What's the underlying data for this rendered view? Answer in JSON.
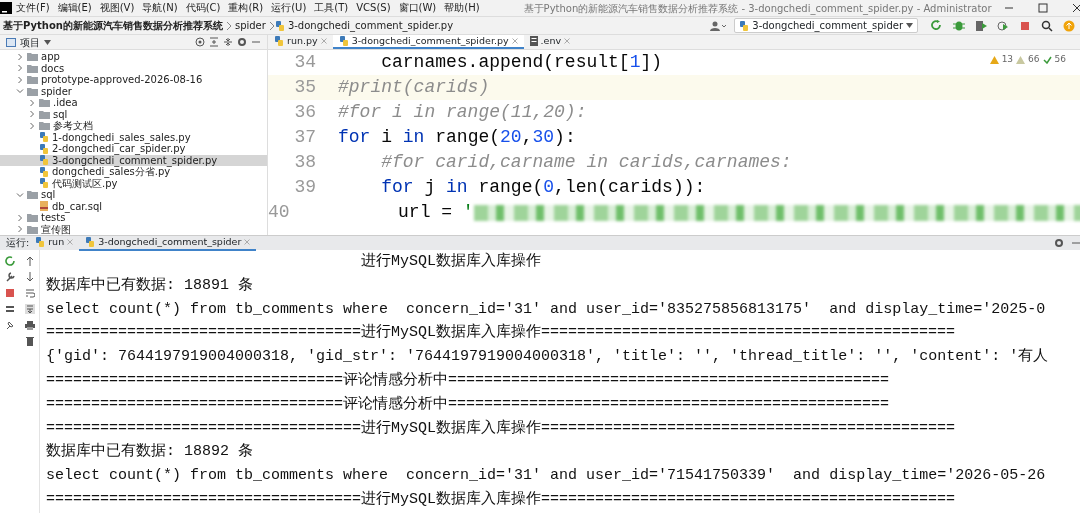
{
  "menu": [
    "文件(F)",
    "编辑(E)",
    "视图(V)",
    "导航(N)",
    "代码(C)",
    "重构(R)",
    "运行(U)",
    "工具(T)",
    "VCS(S)",
    "窗口(W)",
    "帮助(H)"
  ],
  "window": {
    "title": "基于Python的新能源汽车销售数据分析推荐系统 - 3-dongchedi_comment_spider.py - Administrator"
  },
  "breadcrumb": [
    "基于Python的新能源汽车销售数据分析推荐系统",
    "spider",
    "3-dongchedi_comment_spider.py"
  ],
  "run_config": "3-dongchedi_comment_spider",
  "project_panel": {
    "title": "项目",
    "tree": [
      {
        "label": "app",
        "kind": "folder",
        "expanded": false,
        "selected": false
      },
      {
        "label": "docs",
        "kind": "folder",
        "expanded": false,
        "selected": false
      },
      {
        "label": "prototype-approved-2026-08-16",
        "kind": "folder",
        "expanded": false,
        "selected": false
      },
      {
        "label": "spider",
        "kind": "folder",
        "expanded": true,
        "selected": false,
        "children": [
          {
            "label": ".idea",
            "kind": "folder",
            "expanded": false,
            "selected": false
          },
          {
            "label": "sql",
            "kind": "folder",
            "expanded": false,
            "selected": false
          },
          {
            "label": "参考文档",
            "kind": "folder",
            "expanded": false,
            "selected": false
          },
          {
            "label": "1-dongchedi_sales_sales.py",
            "kind": "python",
            "selected": false
          },
          {
            "label": "2-dongchedi_car_spider.py",
            "kind": "python",
            "selected": false
          },
          {
            "label": "3-dongchedi_comment_spider.py",
            "kind": "python",
            "selected": true
          },
          {
            "label": "dongchedi_sales分省.py",
            "kind": "python",
            "selected": false
          },
          {
            "label": "代码测试区.py",
            "kind": "python",
            "selected": false
          }
        ]
      },
      {
        "label": "sql",
        "kind": "folder",
        "expanded": true,
        "selected": false,
        "children": [
          {
            "label": "db_car.sql",
            "kind": "sql",
            "selected": false
          }
        ]
      },
      {
        "label": "tests",
        "kind": "folder",
        "expanded": false,
        "selected": false
      },
      {
        "label": "宣传图",
        "kind": "folder",
        "expanded": false,
        "selected": false
      }
    ]
  },
  "editor_tabs": [
    {
      "label": "run.py",
      "kind": "python",
      "selected": false
    },
    {
      "label": "3-dongchedi_comment_spider.py",
      "kind": "python",
      "selected": true
    },
    {
      "label": ".env",
      "kind": "text",
      "selected": false
    }
  ],
  "inspections": {
    "warnings": "13",
    "weak_warnings": "66",
    "ok": "56"
  },
  "code_lines": [
    {
      "number": "34",
      "current": false,
      "tokens": [
        {
          "kind": "plain",
          "text": "    carnames.append(result["
        },
        {
          "kind": "number",
          "text": "1"
        },
        {
          "kind": "plain",
          "text": "])"
        }
      ]
    },
    {
      "number": "35",
      "current": true,
      "tokens": [
        {
          "kind": "comment",
          "text": "#print(carids)"
        }
      ]
    },
    {
      "number": "36",
      "current": false,
      "tokens": [
        {
          "kind": "comment",
          "text": "#for i in range(11,20):"
        }
      ]
    },
    {
      "number": "37",
      "current": false,
      "tokens": [
        {
          "kind": "keyword",
          "text": "for"
        },
        {
          "kind": "plain",
          "text": " i "
        },
        {
          "kind": "keyword",
          "text": "in"
        },
        {
          "kind": "plain",
          "text": " range("
        },
        {
          "kind": "number",
          "text": "20"
        },
        {
          "kind": "plain",
          "text": ","
        },
        {
          "kind": "number",
          "text": "30"
        },
        {
          "kind": "plain",
          "text": "):"
        }
      ]
    },
    {
      "number": "38",
      "current": false,
      "tokens": [
        {
          "kind": "comment",
          "text": "    #for carid,carname in carids,carnames:"
        }
      ]
    },
    {
      "number": "39",
      "current": false,
      "tokens": [
        {
          "kind": "keyword",
          "text": "    for"
        },
        {
          "kind": "plain",
          "text": " j "
        },
        {
          "kind": "keyword",
          "text": "in"
        },
        {
          "kind": "plain",
          "text": " range("
        },
        {
          "kind": "number",
          "text": "0"
        },
        {
          "kind": "plain",
          "text": ",len(carids)):"
        }
      ]
    },
    {
      "number": "40",
      "current": false,
      "tokens": [
        {
          "kind": "plain",
          "text": "        url = "
        },
        {
          "kind": "string",
          "text": "'"
        },
        {
          "kind": "redacted"
        }
      ]
    }
  ],
  "run_panel": {
    "label": "运行:",
    "tabs": [
      {
        "label": "run",
        "selected": false
      },
      {
        "label": "3-dongchedi_comment_spider",
        "selected": true
      }
    ],
    "console": [
      "                                   进行MySQL数据库入库操作",
      "数据库中已有数据: 18891 条",
      "select count(*) from tb_comments where  concern_id='31' and user_id='835275856813175'  and display_time='2025-0",
      "===================================进行MySQL数据库入库操作==============================================",
      "{'gid': 7644197919004000318, 'gid_str': '7644197919004000318', 'title': '', 'thread_title': '', 'content': '有人",
      "=================================评论情感分析中=================================================",
      "=================================评论情感分析中=================================================",
      "===================================进行MySQL数据库入库操作==============================================",
      "数据库中已有数据: 18892 条",
      "select count(*) from tb_comments where  concern_id='31' and user_id='71541750339'  and display_time='2026-05-26",
      "===================================进行MySQL数据库入库操作=============================================="
    ]
  }
}
